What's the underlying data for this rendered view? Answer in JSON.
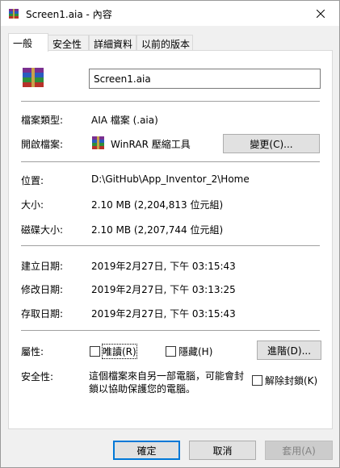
{
  "window": {
    "title": "Screen1.aia - 內容",
    "icon": "winrar-archive-icon"
  },
  "tabs": [
    {
      "label": "一般",
      "active": true
    },
    {
      "label": "安全性",
      "active": false
    },
    {
      "label": "詳細資料",
      "active": false
    },
    {
      "label": "以前的版本",
      "active": false
    }
  ],
  "general": {
    "file_name": "Screen1.aia",
    "type_label": "檔案類型:",
    "type_value": "AIA 檔案 (.aia)",
    "opens_with_label": "開啟檔案:",
    "opens_with_value": "WinRAR 壓縮工具",
    "change_button": "變更(C)...",
    "location_label": "位置:",
    "location_value": "D:\\GitHub\\App_Inventor_2\\Home",
    "size_label": "大小:",
    "size_value": "2.10 MB (2,204,813 位元組)",
    "size_on_disk_label": "磁碟大小:",
    "size_on_disk_value": "2.10 MB (2,207,744 位元組)",
    "created_label": "建立日期:",
    "created_value": "2019年2月27日, 下午 03:15:43",
    "modified_label": "修改日期:",
    "modified_value": "2019年2月27日, 下午 03:13:25",
    "accessed_label": "存取日期:",
    "accessed_value": "2019年2月27日, 下午 03:15:43",
    "attributes_label": "屬性:",
    "readonly_label": "唯讀(R)",
    "readonly_checked": false,
    "hidden_label": "隱藏(H)",
    "hidden_checked": false,
    "advanced_button": "進階(D)...",
    "security_label": "安全性:",
    "security_text": "這個檔案來自另一部電腦，可能會封鎖以協助保護您的電腦。",
    "unblock_label": "解除封鎖(K)",
    "unblock_checked": false
  },
  "footer": {
    "ok_label": "確定",
    "cancel_label": "取消",
    "apply_label": "套用(A)"
  },
  "colors": {
    "focus_blue": "#0078d7",
    "panel_bg": "#ffffff",
    "window_bg": "#f0f0f0"
  }
}
